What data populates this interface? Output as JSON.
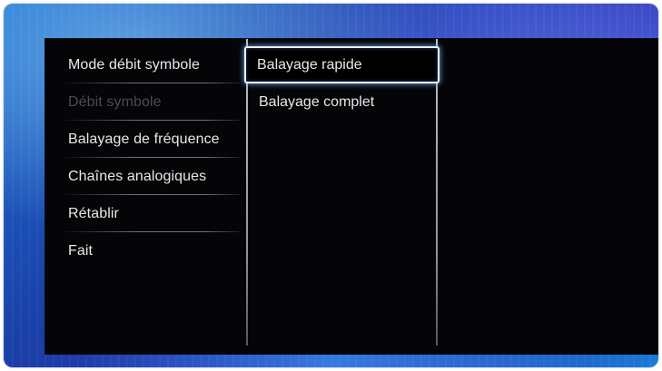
{
  "menu": {
    "items": [
      {
        "label": "Mode débit symbole",
        "enabled": true
      },
      {
        "label": "Débit symbole",
        "enabled": false
      },
      {
        "label": "Balayage de fréquence",
        "enabled": true
      },
      {
        "label": "Chaînes analogiques",
        "enabled": true
      },
      {
        "label": "Rétablir",
        "enabled": true
      },
      {
        "label": "Fait",
        "enabled": true
      }
    ]
  },
  "submenu": {
    "options": [
      {
        "label": "Balayage rapide",
        "selected": true
      },
      {
        "label": "Balayage complet",
        "selected": false
      }
    ]
  },
  "colors": {
    "highlight_border": "#e6f2ff",
    "highlight_glow": "#78b4ff",
    "text": "#e8e8ea",
    "disabled_text": "#4c4c52",
    "screen_bg": "#050507",
    "ambilight_blue": "#1a3fa8"
  }
}
